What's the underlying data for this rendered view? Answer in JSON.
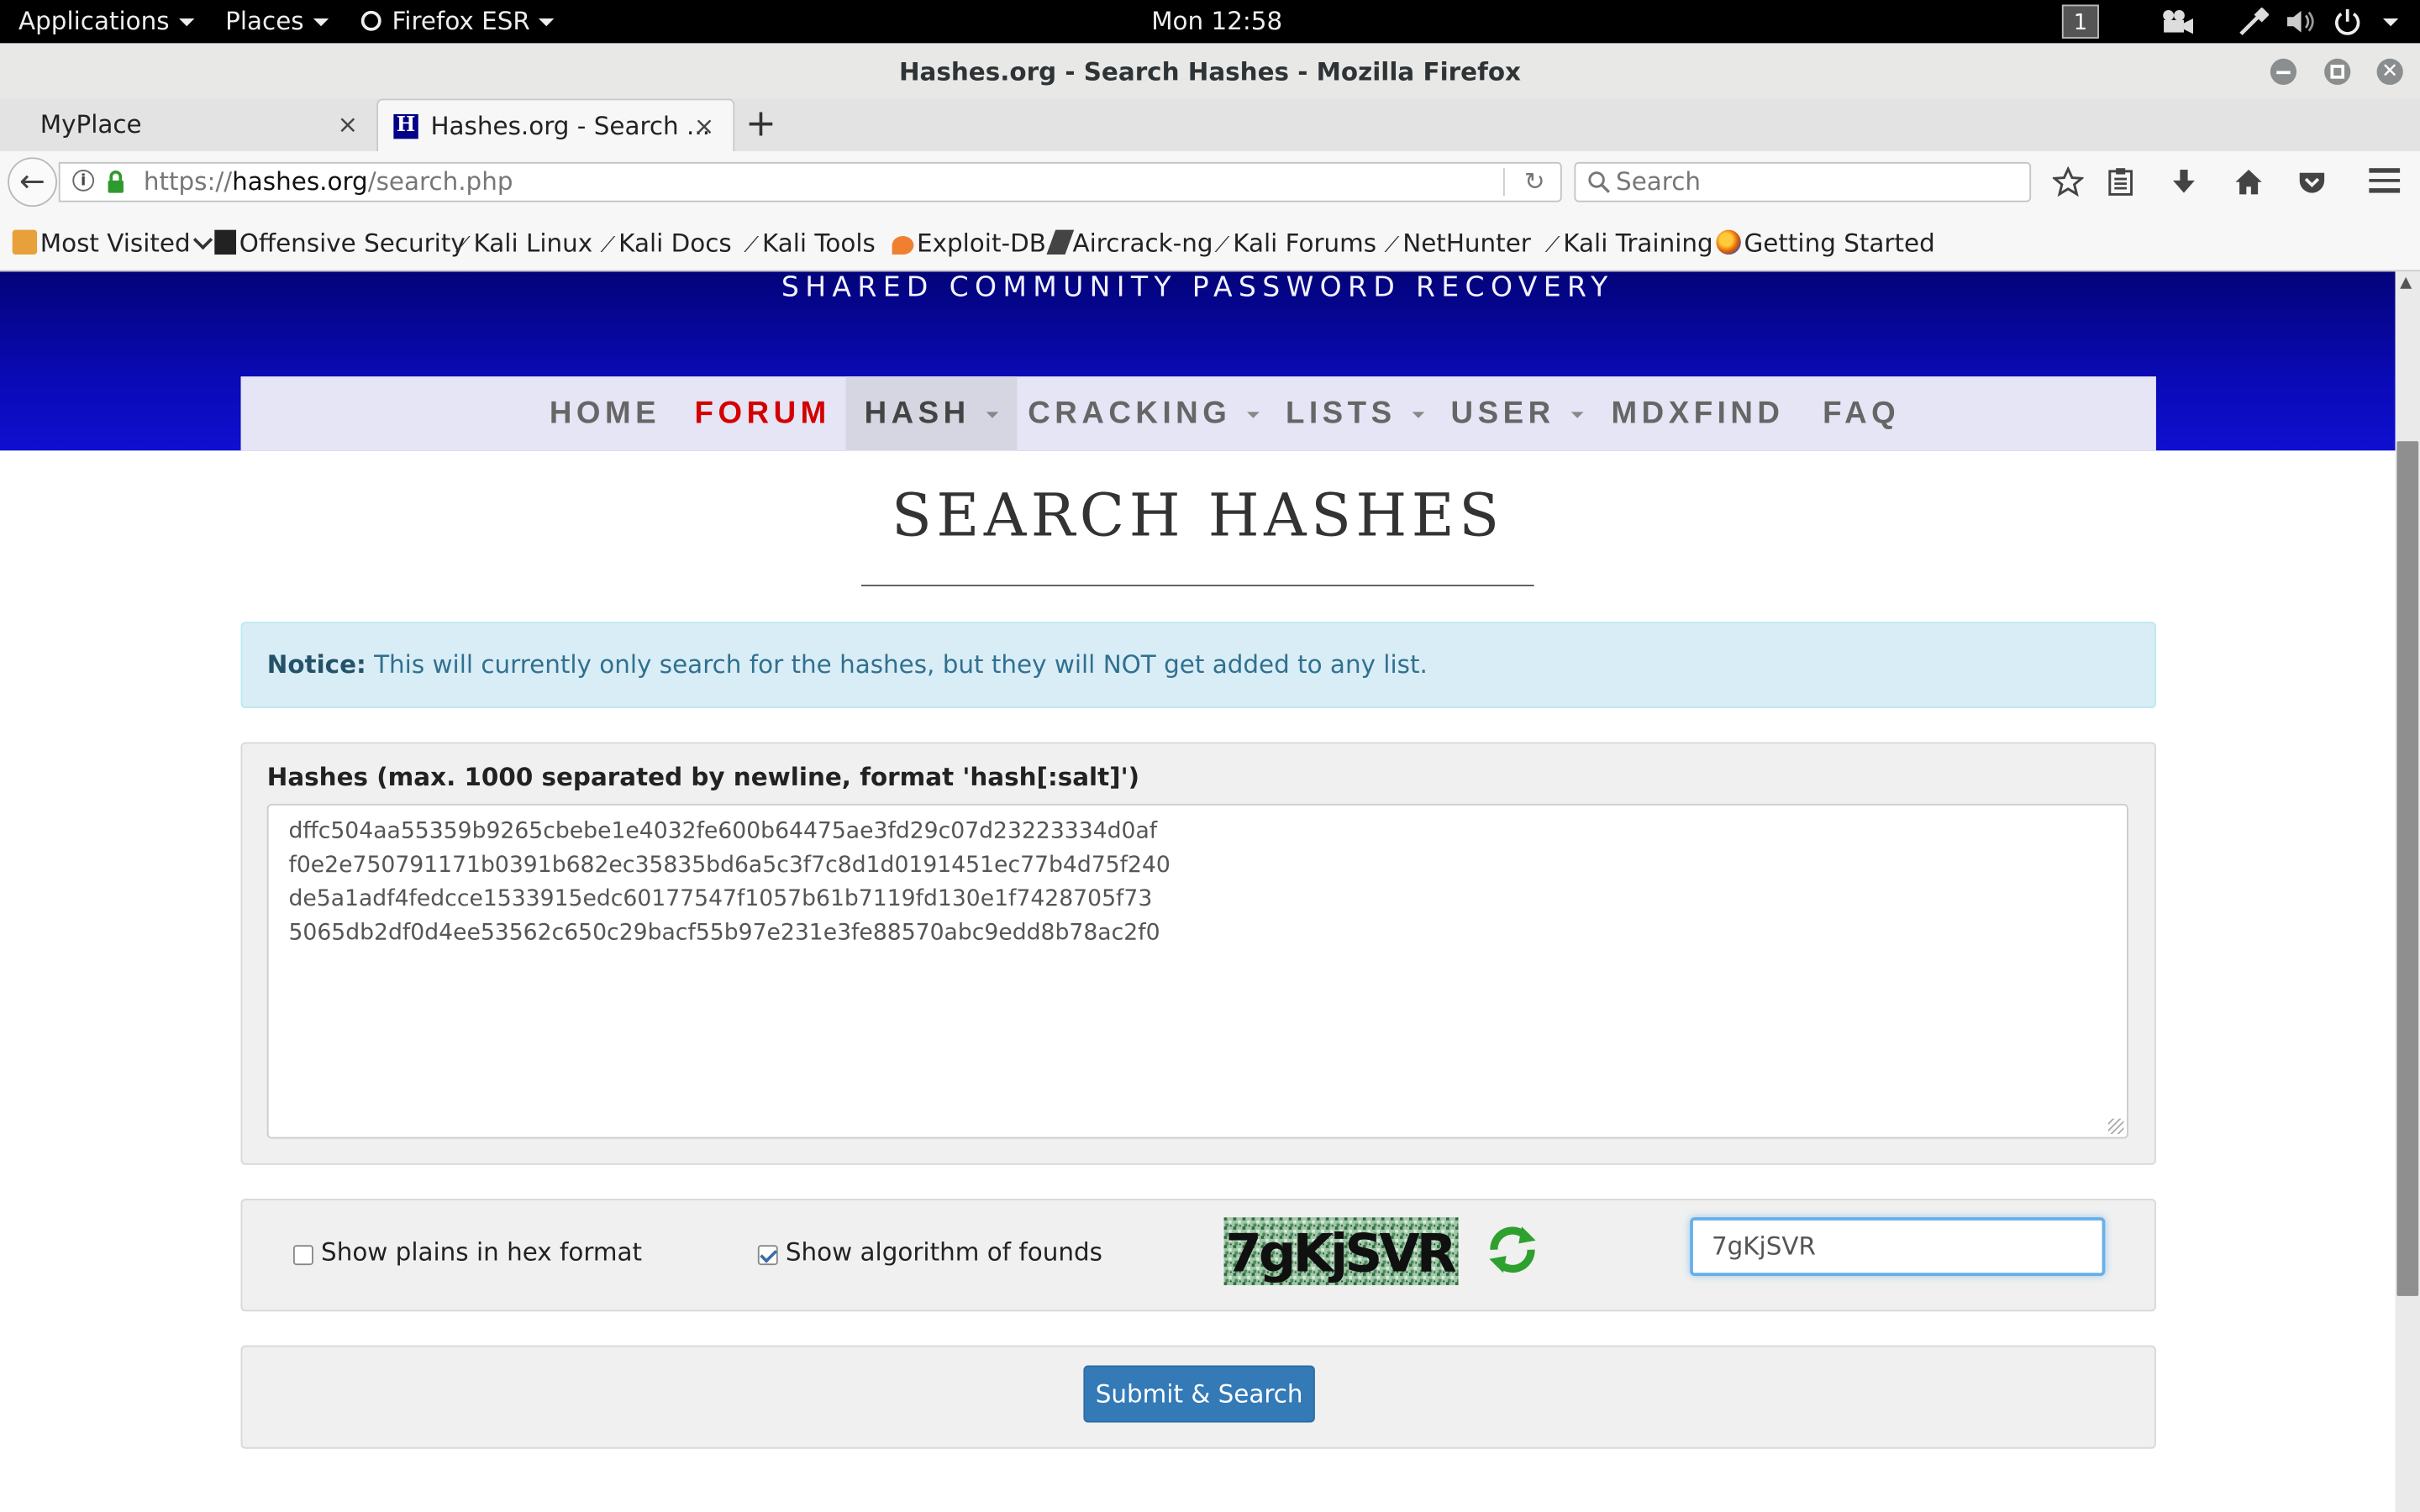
{
  "topbar": {
    "applications": "Applications",
    "places": "Places",
    "firefox": "Firefox ESR",
    "clock": "Mon 12:58",
    "workspace": "1"
  },
  "window": {
    "title": "Hashes.org - Search Hashes - Mozilla Firefox"
  },
  "tabs": [
    {
      "label": "MyPlace",
      "close": "×"
    },
    {
      "label": "Hashes.org - Search ...",
      "close": "×"
    }
  ],
  "navbar": {
    "url_prefix": "https://",
    "url_host": "hashes.org",
    "url_path": "/search.php",
    "search_placeholder": "Search"
  },
  "bookmarks": [
    "Most Visited",
    "Offensive Security",
    "Kali Linux",
    "Kali Docs",
    "Kali Tools",
    "Exploit-DB",
    "Aircrack-ng",
    "Kali Forums",
    "NetHunter",
    "Kali Training",
    "Getting Started"
  ],
  "site": {
    "tagline": "SHARED COMMUNITY PASSWORD RECOVERY",
    "nav": [
      "HOME",
      "FORUM",
      "HASH",
      "CRACKING",
      "LISTS",
      "USER",
      "MDXFIND",
      "FAQ"
    ],
    "page_title": "SEARCH HASHES",
    "notice_label": "Notice:",
    "notice_text": " This will currently only search for the hashes, but they will NOT get added to any list.",
    "hashes_label": "Hashes (max. 1000 separated by newline, format 'hash[:salt]')",
    "hashes": [
      "dffc504aa55359b9265cbebe1e4032fe600b64475ae3fd29c07d23223334d0af",
      "f0e2e750791171b0391b682ec35835bd6a5c3f7c8d1d0191451ec77b4d75f240",
      "de5a1adf4fedcce1533915edc60177547f1057b61b7119fd130e1f7428705f73",
      "5065db2df0d4ee53562c650c29bacf55b97e231e3fe88570abc9edd8b78ac2f0"
    ],
    "opt_hex": "Show plains in hex format",
    "opt_hex_checked": false,
    "opt_algo": "Show algorithm of founds",
    "opt_algo_checked": true,
    "captcha_text": "7gKjSVR",
    "captcha_value": "7gKjSVR",
    "submit": "Submit & Search"
  },
  "colors": {
    "banner_top": "#03037a",
    "banner_bottom": "#0f0fd0",
    "forum_red": "#d40000",
    "notice_bg": "#d9edf7",
    "button_blue": "#337ab7"
  }
}
